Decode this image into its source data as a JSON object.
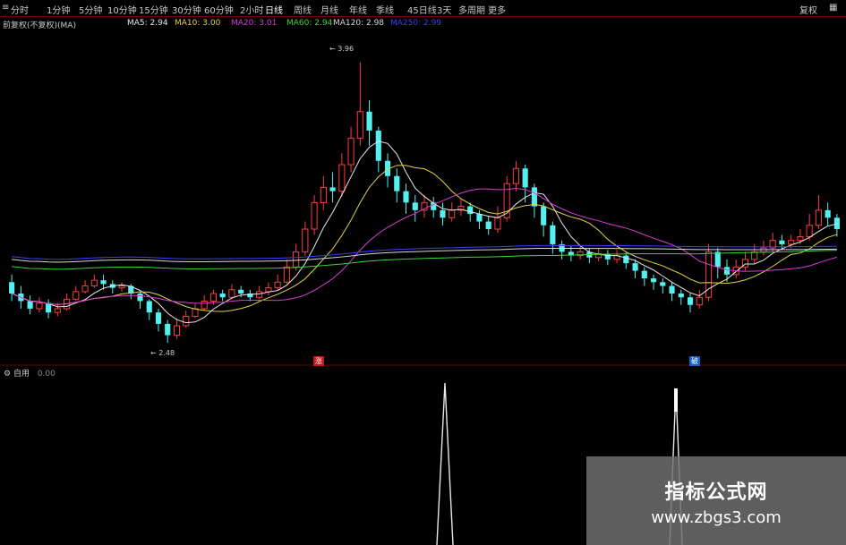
{
  "toolbar": {
    "items": [
      {
        "label": "分时"
      },
      {
        "label": "1分钟"
      },
      {
        "label": "5分钟"
      },
      {
        "label": "10分钟"
      },
      {
        "label": "15分钟"
      },
      {
        "label": "30分钟"
      },
      {
        "label": "60分钟"
      },
      {
        "label": "2小时"
      },
      {
        "label": "日线"
      },
      {
        "label": "周线"
      },
      {
        "label": "月线"
      },
      {
        "label": "年线"
      },
      {
        "label": "季线"
      },
      {
        "label": "45日线"
      },
      {
        "label": "3天"
      },
      {
        "label": "多周期"
      },
      {
        "label": "更多"
      }
    ],
    "active_label": "日线",
    "right_label": "复权"
  },
  "legend": {
    "title": "前复权(不复权)(MA)",
    "items": [
      {
        "label": "MA5: 2.94",
        "color": "#e8e8e8"
      },
      {
        "label": "MA10: 3.00",
        "color": "#e6d246"
      },
      {
        "label": "MA20: 3.01",
        "color": "#d63cd6"
      },
      {
        "label": "MA60: 2.94",
        "color": "#3cd63c"
      },
      {
        "label": "MA120: 2.98",
        "color": "#d8d8d8"
      },
      {
        "label": "MA250: 2.99",
        "color": "#3c3cff"
      }
    ]
  },
  "annotations": {
    "high": "3.96",
    "low": "2.48",
    "marker_1": "涨",
    "marker_2": "破"
  },
  "indicator": {
    "name": "自用",
    "value": "0.00"
  },
  "watermark": {
    "title": "指标公式网",
    "url": "www.zbgs3.com"
  },
  "chart_data": {
    "type": "candlestick",
    "price_range": [
      2.4,
      4.1
    ],
    "candles": [
      [
        2.8,
        2.74,
        2.84,
        2.7
      ],
      [
        2.74,
        2.7,
        2.78,
        2.66
      ],
      [
        2.7,
        2.66,
        2.73,
        2.63
      ],
      [
        2.66,
        2.69,
        2.72,
        2.64
      ],
      [
        2.69,
        2.64,
        2.71,
        2.61
      ],
      [
        2.64,
        2.66,
        2.69,
        2.62
      ],
      [
        2.66,
        2.71,
        2.74,
        2.65
      ],
      [
        2.71,
        2.75,
        2.78,
        2.7
      ],
      [
        2.75,
        2.78,
        2.81,
        2.74
      ],
      [
        2.78,
        2.81,
        2.84,
        2.77
      ],
      [
        2.81,
        2.79,
        2.84,
        2.76
      ],
      [
        2.79,
        2.77,
        2.81,
        2.74
      ],
      [
        2.77,
        2.78,
        2.8,
        2.75
      ],
      [
        2.78,
        2.74,
        2.79,
        2.71
      ],
      [
        2.74,
        2.7,
        2.75,
        2.66
      ],
      [
        2.7,
        2.64,
        2.71,
        2.6
      ],
      [
        2.64,
        2.58,
        2.66,
        2.54
      ],
      [
        2.58,
        2.52,
        2.6,
        2.48
      ],
      [
        2.52,
        2.57,
        2.61,
        2.5
      ],
      [
        2.57,
        2.62,
        2.65,
        2.56
      ],
      [
        2.62,
        2.66,
        2.69,
        2.61
      ],
      [
        2.66,
        2.7,
        2.73,
        2.65
      ],
      [
        2.7,
        2.74,
        2.76,
        2.68
      ],
      [
        2.74,
        2.72,
        2.76,
        2.7
      ],
      [
        2.72,
        2.76,
        2.79,
        2.71
      ],
      [
        2.76,
        2.74,
        2.78,
        2.72
      ],
      [
        2.74,
        2.72,
        2.76,
        2.7
      ],
      [
        2.72,
        2.75,
        2.78,
        2.71
      ],
      [
        2.75,
        2.77,
        2.8,
        2.73
      ],
      [
        2.77,
        2.8,
        2.84,
        2.76
      ],
      [
        2.8,
        2.88,
        2.92,
        2.79
      ],
      [
        2.88,
        2.96,
        3.0,
        2.86
      ],
      [
        2.96,
        3.08,
        3.12,
        2.94
      ],
      [
        3.08,
        3.22,
        3.26,
        3.05
      ],
      [
        3.22,
        3.3,
        3.36,
        3.18
      ],
      [
        3.3,
        3.28,
        3.38,
        3.22
      ],
      [
        3.28,
        3.42,
        3.48,
        3.25
      ],
      [
        3.42,
        3.56,
        3.62,
        3.38
      ],
      [
        3.56,
        3.7,
        3.96,
        3.52
      ],
      [
        3.7,
        3.6,
        3.76,
        3.52
      ],
      [
        3.6,
        3.44,
        3.62,
        3.38
      ],
      [
        3.44,
        3.36,
        3.48,
        3.3
      ],
      [
        3.36,
        3.28,
        3.4,
        3.22
      ],
      [
        3.28,
        3.22,
        3.32,
        3.16
      ],
      [
        3.22,
        3.18,
        3.26,
        3.12
      ],
      [
        3.18,
        3.22,
        3.26,
        3.14
      ],
      [
        3.22,
        3.18,
        3.25,
        3.14
      ],
      [
        3.18,
        3.14,
        3.22,
        3.1
      ],
      [
        3.14,
        3.18,
        3.22,
        3.12
      ],
      [
        3.18,
        3.2,
        3.24,
        3.15
      ],
      [
        3.2,
        3.16,
        3.22,
        3.12
      ],
      [
        3.16,
        3.12,
        3.18,
        3.08
      ],
      [
        3.12,
        3.08,
        3.15,
        3.05
      ],
      [
        3.08,
        3.14,
        3.2,
        3.06
      ],
      [
        3.14,
        3.32,
        3.36,
        3.12
      ],
      [
        3.32,
        3.4,
        3.44,
        3.28
      ],
      [
        3.4,
        3.3,
        3.42,
        3.22
      ],
      [
        3.3,
        3.2,
        3.32,
        3.14
      ],
      [
        3.2,
        3.1,
        3.22,
        3.04
      ],
      [
        3.1,
        3.0,
        3.12,
        2.95
      ],
      [
        3.0,
        2.96,
        3.02,
        2.92
      ],
      [
        2.96,
        2.94,
        2.99,
        2.91
      ],
      [
        2.94,
        2.96,
        2.99,
        2.92
      ],
      [
        2.96,
        2.93,
        2.98,
        2.9
      ],
      [
        2.93,
        2.95,
        2.98,
        2.91
      ],
      [
        2.95,
        2.92,
        2.97,
        2.89
      ],
      [
        2.92,
        2.94,
        2.97,
        2.9
      ],
      [
        2.94,
        2.9,
        2.96,
        2.87
      ],
      [
        2.9,
        2.86,
        2.92,
        2.82
      ],
      [
        2.86,
        2.82,
        2.88,
        2.78
      ],
      [
        2.82,
        2.8,
        2.84,
        2.76
      ],
      [
        2.8,
        2.78,
        2.82,
        2.74
      ],
      [
        2.78,
        2.74,
        2.8,
        2.7
      ],
      [
        2.74,
        2.72,
        2.76,
        2.68
      ],
      [
        2.72,
        2.68,
        2.74,
        2.64
      ],
      [
        2.68,
        2.72,
        2.76,
        2.66
      ],
      [
        2.72,
        2.96,
        3.0,
        2.7
      ],
      [
        2.96,
        2.88,
        2.98,
        2.82
      ],
      [
        2.88,
        2.84,
        2.92,
        2.8
      ],
      [
        2.84,
        2.88,
        2.92,
        2.82
      ],
      [
        2.88,
        2.92,
        2.96,
        2.86
      ],
      [
        2.92,
        2.96,
        3.0,
        2.9
      ],
      [
        2.96,
        2.98,
        3.02,
        2.94
      ],
      [
        2.98,
        3.02,
        3.06,
        2.96
      ],
      [
        3.02,
        3.0,
        3.05,
        2.97
      ],
      [
        3.0,
        3.02,
        3.05,
        2.98
      ],
      [
        3.02,
        3.04,
        3.08,
        3.0
      ],
      [
        3.04,
        3.1,
        3.16,
        3.02
      ],
      [
        3.1,
        3.18,
        3.26,
        3.08
      ],
      [
        3.18,
        3.14,
        3.22,
        3.1
      ],
      [
        3.14,
        3.08,
        3.16,
        3.04
      ]
    ]
  }
}
